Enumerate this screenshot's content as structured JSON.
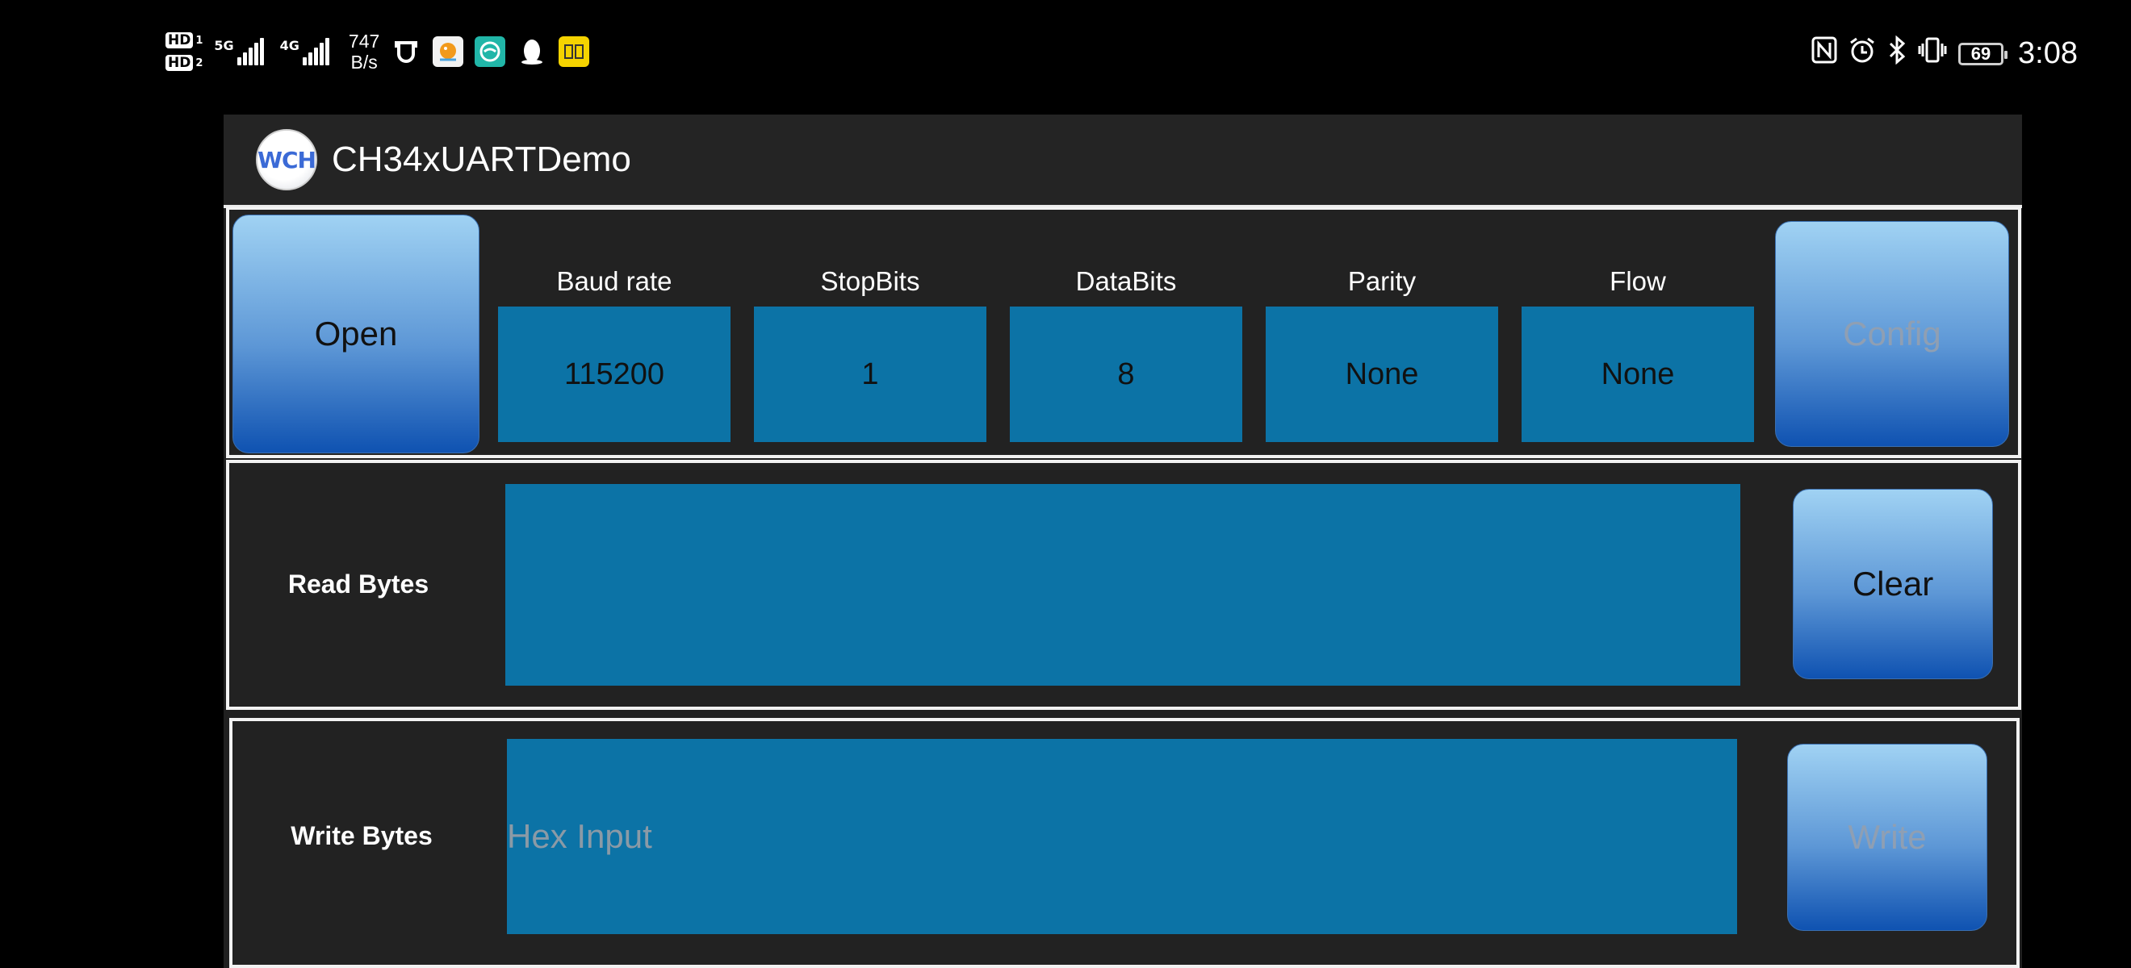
{
  "status_bar": {
    "sim1_label": "HD",
    "sim1_index": "1",
    "sim2_label": "HD",
    "sim2_index": "2",
    "net1": "5G",
    "net2": "4G",
    "speed_value": "747",
    "speed_unit": "B/s",
    "battery": "69",
    "time": "3:08",
    "icons": [
      "hd-icon",
      "signal-icon",
      "app-shield-icon",
      "app-bird-icon",
      "app-green-icon",
      "qq-penguin-icon",
      "app-yellow-icon",
      "nfc-icon",
      "alarm-icon",
      "bluetooth-icon",
      "vibrate-icon",
      "battery-icon"
    ]
  },
  "app": {
    "logo_text": "WCH",
    "title": "CH34xUARTDemo"
  },
  "config": {
    "open_label": "Open",
    "config_label": "Config",
    "params": [
      {
        "label": "Baud rate",
        "value": "115200"
      },
      {
        "label": "StopBits",
        "value": "1"
      },
      {
        "label": "DataBits",
        "value": "8"
      },
      {
        "label": "Parity",
        "value": "None"
      },
      {
        "label": "Flow",
        "value": "None"
      }
    ]
  },
  "read": {
    "label": "Read Bytes",
    "content": "",
    "clear_label": "Clear"
  },
  "write": {
    "label": "Write Bytes",
    "value": "",
    "placeholder": "Hex Input",
    "write_label": "Write"
  },
  "colors": {
    "accent_box": "#0c73a6",
    "button_top": "#a0d2f3",
    "button_bottom": "#0f52b1",
    "panel_bg": "#222222",
    "border": "#f2f2f2"
  }
}
